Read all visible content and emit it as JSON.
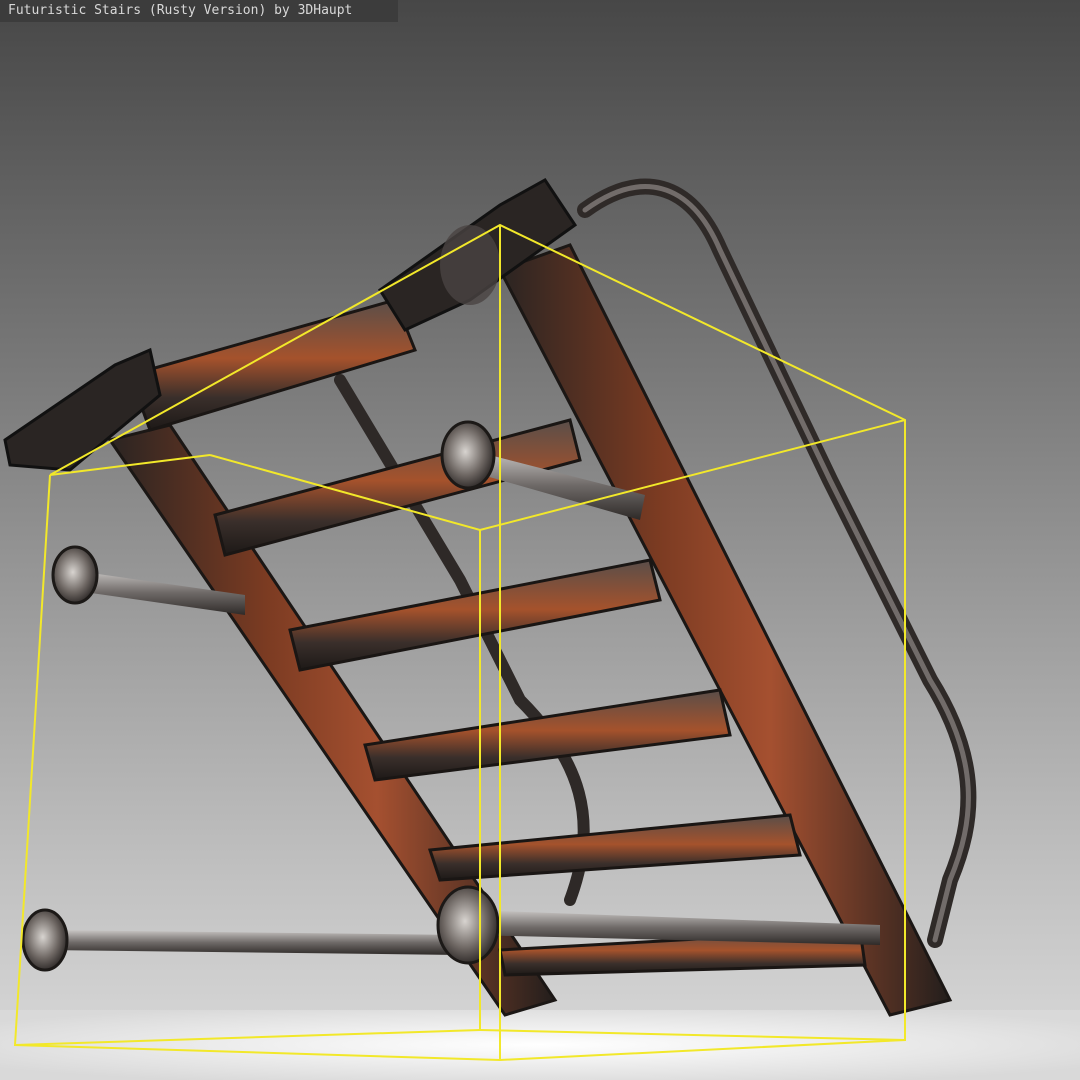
{
  "viewer": {
    "title": "Futuristic Stairs (Rusty Version) by 3DHaupt"
  },
  "colors": {
    "background_top": "#4a4a4a",
    "background_bottom": "#d6d6d6",
    "floor": "#f2f2f2",
    "bounding_box": "#f2e82a",
    "metal_dark": "#2b2624",
    "metal_mid": "#6b5f5a",
    "rust": "#b0502a",
    "steel": "#9a9696"
  },
  "icons": {
    "model": "stairs-model",
    "bounds": "bounding-box-wireframe"
  }
}
